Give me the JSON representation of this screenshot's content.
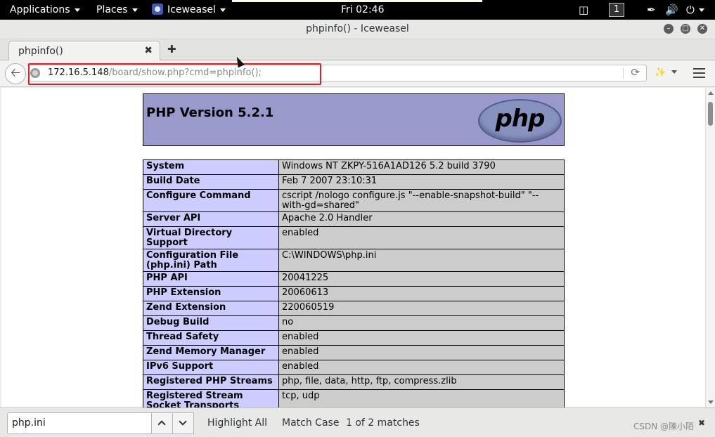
{
  "topbar": {
    "applications": "Applications",
    "places": "Places",
    "active_app": "Iceweasel",
    "clock": "Fri 02:46",
    "workspace": "1"
  },
  "window": {
    "title": "phpinfo() - Iceweasel"
  },
  "tabs": [
    {
      "label": "phpinfo()"
    }
  ],
  "navbar": {
    "url_host": "172.16.5.148",
    "url_path": "/board/show.php?cmd=phpinfo();"
  },
  "page": {
    "header_title": "PHP Version 5.2.1",
    "logo_text": "php",
    "rows": [
      {
        "key": "System",
        "value": "Windows NT ZKPY-516A1AD126 5.2 build 3790"
      },
      {
        "key": "Build Date",
        "value": "Feb 7 2007 23:10:31"
      },
      {
        "key": "Configure Command",
        "value": "cscript /nologo configure.js \"--enable-snapshot-build\" \"--with-gd=shared\""
      },
      {
        "key": "Server API",
        "value": "Apache 2.0 Handler"
      },
      {
        "key": "Virtual Directory Support",
        "value": "enabled"
      },
      {
        "key": "Configuration File (php.ini) Path",
        "value": "C:\\WINDOWS\\php.ini"
      },
      {
        "key": "PHP API",
        "value": "20041225"
      },
      {
        "key": "PHP Extension",
        "value": "20060613"
      },
      {
        "key": "Zend Extension",
        "value": "220060519"
      },
      {
        "key": "Debug Build",
        "value": "no"
      },
      {
        "key": "Thread Safety",
        "value": "enabled"
      },
      {
        "key": "Zend Memory Manager",
        "value": "enabled"
      },
      {
        "key": "IPv6 Support",
        "value": "enabled"
      },
      {
        "key": "Registered PHP Streams",
        "value": "php, file, data, http, ftp, compress.zlib"
      },
      {
        "key": "Registered Stream Socket Transports",
        "value": "tcp, udp"
      }
    ]
  },
  "findbar": {
    "query": "php.ini",
    "highlight_all": "Highlight All",
    "match_case": "Match Case",
    "status": "1 of 2 matches"
  },
  "watermark": "CSDN @陳小陌",
  "colors": {
    "php_header": "#9999cc",
    "key_cell": "#ccccff",
    "value_cell": "#cccccc",
    "url_highlight": "#e02020"
  },
  "icons": {
    "back": "arrow-left-icon",
    "reload": "reload-icon",
    "menu": "hamburger-menu-icon",
    "power": "power-icon",
    "volume": "volume-icon"
  }
}
